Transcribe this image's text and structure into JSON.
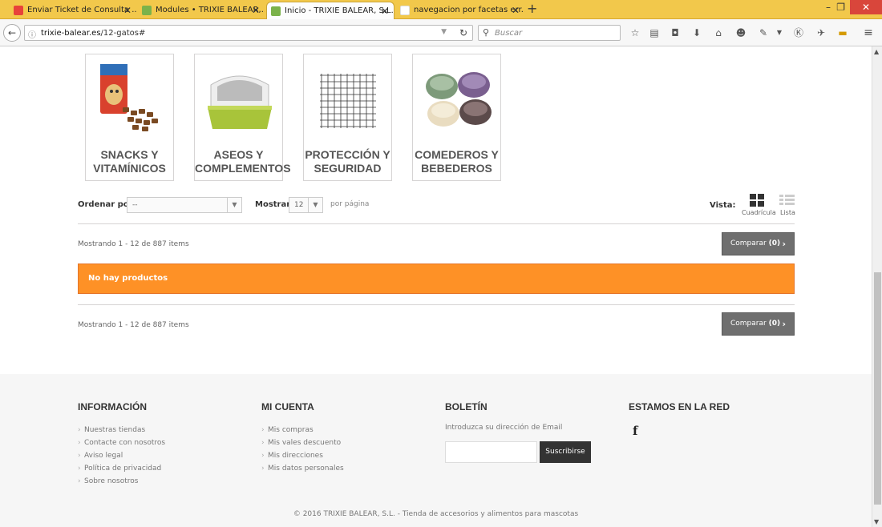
{
  "browser": {
    "tabs": [
      {
        "label": "Enviar Ticket de Consulta ...",
        "favicon_color": "#e8423a"
      },
      {
        "label": "Modules • TRIXIE BALEAR,...",
        "favicon_color": "#7bb24a"
      },
      {
        "label": "Inicio - TRIXIE BALEAR, S.L...",
        "favicon_color": "#7bb24a"
      },
      {
        "label": "navegacion por facetas err...",
        "favicon_color": "#4285f4"
      }
    ],
    "url_host": "trixie-balear.es",
    "url_path": "/12-gatos#",
    "search_placeholder": "Buscar"
  },
  "categories": [
    {
      "label": "SNACKS Y VITAMÍNICOS",
      "icon": "snack-bag-image"
    },
    {
      "label": "ASEOS Y COMPLEMENTOS",
      "icon": "litter-box-image"
    },
    {
      "label": "PROTECCIÓN Y SEGURIDAD",
      "icon": "protection-net-image"
    },
    {
      "label": "COMEDEROS Y BEBEDEROS",
      "icon": "feeding-bowls-image"
    }
  ],
  "sort": {
    "order_label": "Ordenar por",
    "order_value": "--",
    "show_label": "Mostrar",
    "show_value": "12",
    "per_page": "por página",
    "view_label": "Vista:",
    "grid_label": "Cuadrícula",
    "list_label": "Lista"
  },
  "listing": {
    "count_text": "Mostrando 1 - 12 de 887 items",
    "compare_label": "Comparar",
    "compare_count": "(0)",
    "alert": "No hay productos"
  },
  "footer": {
    "info_title": "INFORMACIÓN",
    "info_items": [
      "Nuestras tiendas",
      "Contacte con nosotros",
      "Aviso legal",
      "Política de privacidad",
      "Sobre nosotros"
    ],
    "account_title": "MI CUENTA",
    "account_items": [
      "Mis compras",
      "Mis vales descuento",
      "Mis direcciones",
      "Mis datos personales"
    ],
    "newsletter_title": "BOLETÍN",
    "newsletter_text": "Introduzca su dirección de Email",
    "newsletter_button": "Suscribirse",
    "social_title": "ESTAMOS EN LA RED",
    "social_icon": "facebook-icon",
    "copyright": "© 2016 TRIXIE BALEAR, S.L. - Tienda de accesorios y alimentos para mascotas"
  },
  "colors": {
    "tabbar": "#f2c84b",
    "alert": "#fe9126",
    "compare": "#6f6f6f"
  }
}
